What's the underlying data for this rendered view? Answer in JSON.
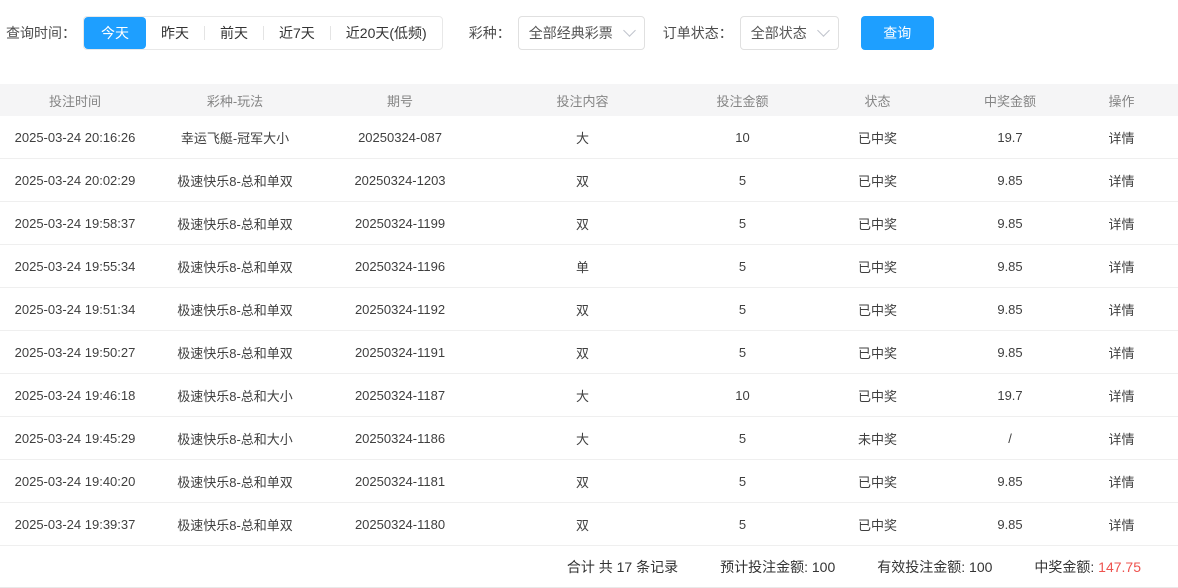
{
  "colors": {
    "primary_blue": "#1e9fff",
    "link_blue": "#3da8f3",
    "alert_red": "#ee534f",
    "header_bg": "#f5f5f6"
  },
  "filters": {
    "time_label": "查询时间：",
    "time_options": [
      {
        "label": "今天",
        "active": true
      },
      {
        "label": "昨天",
        "active": false
      },
      {
        "label": "前天",
        "active": false
      },
      {
        "label": "近7天",
        "active": false
      },
      {
        "label": "近20天(低频)",
        "active": false
      }
    ],
    "lottery_label": "彩种：",
    "lottery_value": "全部经典彩票",
    "status_label": "订单状态：",
    "status_value": "全部状态",
    "search_button": "查询"
  },
  "table": {
    "columns": [
      "投注时间",
      "彩种-玩法",
      "期号",
      "投注内容",
      "投注金额",
      "状态",
      "中奖金额",
      "操作"
    ],
    "won_status_text": "已中奖",
    "rows": [
      {
        "time": "2025-03-24 20:16:26",
        "game": "幸运飞艇-冠军大小",
        "issue": "20250324-087",
        "content": "大",
        "amount": "10",
        "status": "已中奖",
        "win": "19.7",
        "action": "详情"
      },
      {
        "time": "2025-03-24 20:02:29",
        "game": "极速快乐8-总和单双",
        "issue": "20250324-1203",
        "content": "双",
        "amount": "5",
        "status": "已中奖",
        "win": "9.85",
        "action": "详情"
      },
      {
        "time": "2025-03-24 19:58:37",
        "game": "极速快乐8-总和单双",
        "issue": "20250324-1199",
        "content": "双",
        "amount": "5",
        "status": "已中奖",
        "win": "9.85",
        "action": "详情"
      },
      {
        "time": "2025-03-24 19:55:34",
        "game": "极速快乐8-总和单双",
        "issue": "20250324-1196",
        "content": "单",
        "amount": "5",
        "status": "已中奖",
        "win": "9.85",
        "action": "详情"
      },
      {
        "time": "2025-03-24 19:51:34",
        "game": "极速快乐8-总和单双",
        "issue": "20250324-1192",
        "content": "双",
        "amount": "5",
        "status": "已中奖",
        "win": "9.85",
        "action": "详情"
      },
      {
        "time": "2025-03-24 19:50:27",
        "game": "极速快乐8-总和单双",
        "issue": "20250324-1191",
        "content": "双",
        "amount": "5",
        "status": "已中奖",
        "win": "9.85",
        "action": "详情"
      },
      {
        "time": "2025-03-24 19:46:18",
        "game": "极速快乐8-总和大小",
        "issue": "20250324-1187",
        "content": "大",
        "amount": "10",
        "status": "已中奖",
        "win": "19.7",
        "action": "详情"
      },
      {
        "time": "2025-03-24 19:45:29",
        "game": "极速快乐8-总和大小",
        "issue": "20250324-1186",
        "content": "大",
        "amount": "5",
        "status": "未中奖",
        "win": "/",
        "action": "详情"
      },
      {
        "time": "2025-03-24 19:40:20",
        "game": "极速快乐8-总和单双",
        "issue": "20250324-1181",
        "content": "双",
        "amount": "5",
        "status": "已中奖",
        "win": "9.85",
        "action": "详情"
      },
      {
        "time": "2025-03-24 19:39:37",
        "game": "极速快乐8-总和单双",
        "issue": "20250324-1180",
        "content": "双",
        "amount": "5",
        "status": "已中奖",
        "win": "9.85",
        "action": "详情"
      }
    ]
  },
  "summary": {
    "total_records": "合计 共 17 条记录",
    "expected_label": "预计投注金额:",
    "expected_value": "100",
    "valid_label": "有效投注金额:",
    "valid_value": "100",
    "win_label": "中奖金额:",
    "win_value": "147.75"
  }
}
